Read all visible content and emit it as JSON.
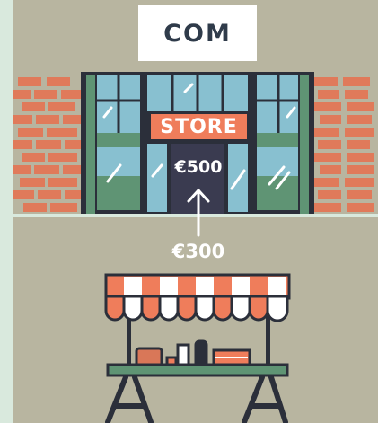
{
  "header": {
    "title": "COM"
  },
  "store": {
    "sign": "STORE",
    "price": "€500"
  },
  "stall": {
    "price": "€300"
  },
  "colors": {
    "background": "#d9e9dd",
    "ground": "#b8b5a0",
    "brick": "#e07a5a",
    "window": "#88c0d0",
    "frame": "#2b2f3a",
    "awning_orange": "#ef7d5b",
    "table": "#5f9474"
  }
}
